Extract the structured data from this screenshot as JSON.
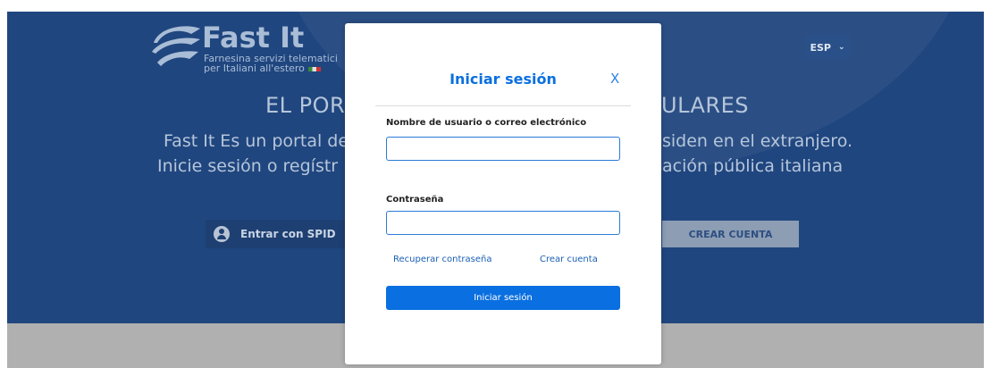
{
  "logo": {
    "title": "Fast It",
    "subtitle_line1": "Farnesina servizi telematici",
    "subtitle_line2": "per Italiani all'estero"
  },
  "language": {
    "selected": "ESP"
  },
  "hero": {
    "title_left": "EL POR",
    "title_right": "ULARES",
    "line1_left": "Fast It Es un portal de",
    "line1_right": "siden en el extranjero.",
    "line2_left": "Inicie sesión o regístr",
    "line2_right": "ación pública italiana"
  },
  "buttons": {
    "spid": "Entrar con SPID",
    "create_account": "CREAR CUENTA"
  },
  "modal": {
    "title": "Iniciar sesión",
    "close": "X",
    "username_label": "Nombre de usuario o correo electrónico",
    "username_value": "",
    "password_label": "Contraseña",
    "password_value": "",
    "recover_link": "Recuperar contraseña",
    "create_link": "Crear cuenta",
    "submit": "Iniciar sesión"
  },
  "colors": {
    "hero_background": "#20467f",
    "primary_blue": "#0a6fe0",
    "link_blue": "#1a5fb4"
  }
}
